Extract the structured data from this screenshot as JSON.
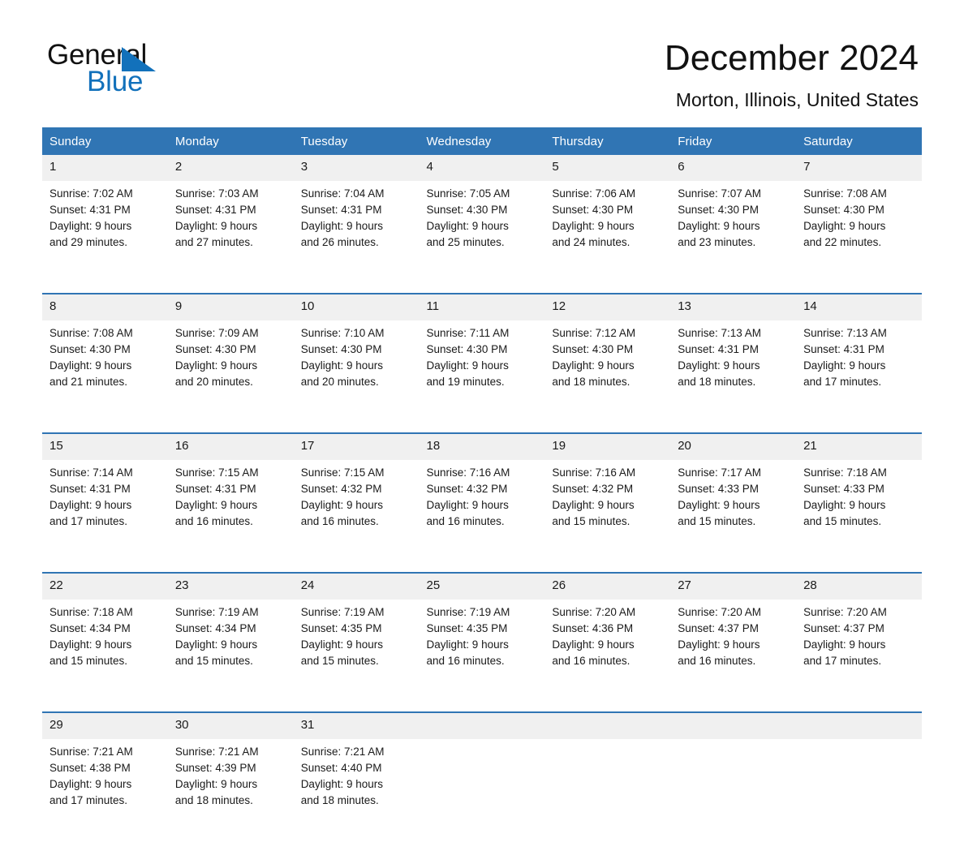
{
  "logo": {
    "word_black": "General",
    "word_blue": "Blue",
    "triangle_icon": "blue-triangle-icon"
  },
  "header": {
    "title": "December 2024",
    "subtitle": "Morton, Illinois, United States"
  },
  "colors": {
    "header_blue": "#3075b4",
    "logo_blue": "#1271bb",
    "daynum_gray": "#f0f0f0",
    "text": "#1a1a1a",
    "white": "#ffffff"
  },
  "calendar": {
    "weekdays": [
      "Sunday",
      "Monday",
      "Tuesday",
      "Wednesday",
      "Thursday",
      "Friday",
      "Saturday"
    ],
    "weeks": [
      {
        "days": [
          {
            "num": "1",
            "sunrise": "Sunrise: 7:02 AM",
            "sunset": "Sunset: 4:31 PM",
            "daylight1": "Daylight: 9 hours",
            "daylight2": "and 29 minutes."
          },
          {
            "num": "2",
            "sunrise": "Sunrise: 7:03 AM",
            "sunset": "Sunset: 4:31 PM",
            "daylight1": "Daylight: 9 hours",
            "daylight2": "and 27 minutes."
          },
          {
            "num": "3",
            "sunrise": "Sunrise: 7:04 AM",
            "sunset": "Sunset: 4:31 PM",
            "daylight1": "Daylight: 9 hours",
            "daylight2": "and 26 minutes."
          },
          {
            "num": "4",
            "sunrise": "Sunrise: 7:05 AM",
            "sunset": "Sunset: 4:30 PM",
            "daylight1": "Daylight: 9 hours",
            "daylight2": "and 25 minutes."
          },
          {
            "num": "5",
            "sunrise": "Sunrise: 7:06 AM",
            "sunset": "Sunset: 4:30 PM",
            "daylight1": "Daylight: 9 hours",
            "daylight2": "and 24 minutes."
          },
          {
            "num": "6",
            "sunrise": "Sunrise: 7:07 AM",
            "sunset": "Sunset: 4:30 PM",
            "daylight1": "Daylight: 9 hours",
            "daylight2": "and 23 minutes."
          },
          {
            "num": "7",
            "sunrise": "Sunrise: 7:08 AM",
            "sunset": "Sunset: 4:30 PM",
            "daylight1": "Daylight: 9 hours",
            "daylight2": "and 22 minutes."
          }
        ]
      },
      {
        "days": [
          {
            "num": "8",
            "sunrise": "Sunrise: 7:08 AM",
            "sunset": "Sunset: 4:30 PM",
            "daylight1": "Daylight: 9 hours",
            "daylight2": "and 21 minutes."
          },
          {
            "num": "9",
            "sunrise": "Sunrise: 7:09 AM",
            "sunset": "Sunset: 4:30 PM",
            "daylight1": "Daylight: 9 hours",
            "daylight2": "and 20 minutes."
          },
          {
            "num": "10",
            "sunrise": "Sunrise: 7:10 AM",
            "sunset": "Sunset: 4:30 PM",
            "daylight1": "Daylight: 9 hours",
            "daylight2": "and 20 minutes."
          },
          {
            "num": "11",
            "sunrise": "Sunrise: 7:11 AM",
            "sunset": "Sunset: 4:30 PM",
            "daylight1": "Daylight: 9 hours",
            "daylight2": "and 19 minutes."
          },
          {
            "num": "12",
            "sunrise": "Sunrise: 7:12 AM",
            "sunset": "Sunset: 4:30 PM",
            "daylight1": "Daylight: 9 hours",
            "daylight2": "and 18 minutes."
          },
          {
            "num": "13",
            "sunrise": "Sunrise: 7:13 AM",
            "sunset": "Sunset: 4:31 PM",
            "daylight1": "Daylight: 9 hours",
            "daylight2": "and 18 minutes."
          },
          {
            "num": "14",
            "sunrise": "Sunrise: 7:13 AM",
            "sunset": "Sunset: 4:31 PM",
            "daylight1": "Daylight: 9 hours",
            "daylight2": "and 17 minutes."
          }
        ]
      },
      {
        "days": [
          {
            "num": "15",
            "sunrise": "Sunrise: 7:14 AM",
            "sunset": "Sunset: 4:31 PM",
            "daylight1": "Daylight: 9 hours",
            "daylight2": "and 17 minutes."
          },
          {
            "num": "16",
            "sunrise": "Sunrise: 7:15 AM",
            "sunset": "Sunset: 4:31 PM",
            "daylight1": "Daylight: 9 hours",
            "daylight2": "and 16 minutes."
          },
          {
            "num": "17",
            "sunrise": "Sunrise: 7:15 AM",
            "sunset": "Sunset: 4:32 PM",
            "daylight1": "Daylight: 9 hours",
            "daylight2": "and 16 minutes."
          },
          {
            "num": "18",
            "sunrise": "Sunrise: 7:16 AM",
            "sunset": "Sunset: 4:32 PM",
            "daylight1": "Daylight: 9 hours",
            "daylight2": "and 16 minutes."
          },
          {
            "num": "19",
            "sunrise": "Sunrise: 7:16 AM",
            "sunset": "Sunset: 4:32 PM",
            "daylight1": "Daylight: 9 hours",
            "daylight2": "and 15 minutes."
          },
          {
            "num": "20",
            "sunrise": "Sunrise: 7:17 AM",
            "sunset": "Sunset: 4:33 PM",
            "daylight1": "Daylight: 9 hours",
            "daylight2": "and 15 minutes."
          },
          {
            "num": "21",
            "sunrise": "Sunrise: 7:18 AM",
            "sunset": "Sunset: 4:33 PM",
            "daylight1": "Daylight: 9 hours",
            "daylight2": "and 15 minutes."
          }
        ]
      },
      {
        "days": [
          {
            "num": "22",
            "sunrise": "Sunrise: 7:18 AM",
            "sunset": "Sunset: 4:34 PM",
            "daylight1": "Daylight: 9 hours",
            "daylight2": "and 15 minutes."
          },
          {
            "num": "23",
            "sunrise": "Sunrise: 7:19 AM",
            "sunset": "Sunset: 4:34 PM",
            "daylight1": "Daylight: 9 hours",
            "daylight2": "and 15 minutes."
          },
          {
            "num": "24",
            "sunrise": "Sunrise: 7:19 AM",
            "sunset": "Sunset: 4:35 PM",
            "daylight1": "Daylight: 9 hours",
            "daylight2": "and 15 minutes."
          },
          {
            "num": "25",
            "sunrise": "Sunrise: 7:19 AM",
            "sunset": "Sunset: 4:35 PM",
            "daylight1": "Daylight: 9 hours",
            "daylight2": "and 16 minutes."
          },
          {
            "num": "26",
            "sunrise": "Sunrise: 7:20 AM",
            "sunset": "Sunset: 4:36 PM",
            "daylight1": "Daylight: 9 hours",
            "daylight2": "and 16 minutes."
          },
          {
            "num": "27",
            "sunrise": "Sunrise: 7:20 AM",
            "sunset": "Sunset: 4:37 PM",
            "daylight1": "Daylight: 9 hours",
            "daylight2": "and 16 minutes."
          },
          {
            "num": "28",
            "sunrise": "Sunrise: 7:20 AM",
            "sunset": "Sunset: 4:37 PM",
            "daylight1": "Daylight: 9 hours",
            "daylight2": "and 17 minutes."
          }
        ]
      },
      {
        "days": [
          {
            "num": "29",
            "sunrise": "Sunrise: 7:21 AM",
            "sunset": "Sunset: 4:38 PM",
            "daylight1": "Daylight: 9 hours",
            "daylight2": "and 17 minutes."
          },
          {
            "num": "30",
            "sunrise": "Sunrise: 7:21 AM",
            "sunset": "Sunset: 4:39 PM",
            "daylight1": "Daylight: 9 hours",
            "daylight2": "and 18 minutes."
          },
          {
            "num": "31",
            "sunrise": "Sunrise: 7:21 AM",
            "sunset": "Sunset: 4:40 PM",
            "daylight1": "Daylight: 9 hours",
            "daylight2": "and 18 minutes."
          },
          {
            "num": "",
            "sunrise": "",
            "sunset": "",
            "daylight1": "",
            "daylight2": ""
          },
          {
            "num": "",
            "sunrise": "",
            "sunset": "",
            "daylight1": "",
            "daylight2": ""
          },
          {
            "num": "",
            "sunrise": "",
            "sunset": "",
            "daylight1": "",
            "daylight2": ""
          },
          {
            "num": "",
            "sunrise": "",
            "sunset": "",
            "daylight1": "",
            "daylight2": ""
          }
        ]
      }
    ]
  }
}
